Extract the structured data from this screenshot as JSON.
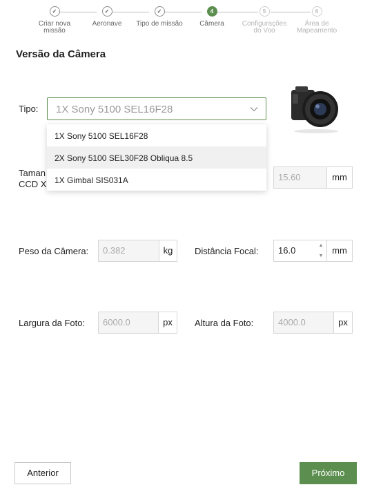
{
  "stepper": {
    "steps": [
      {
        "label1": "Criar nova",
        "label2": "missão",
        "state": "done",
        "num": ""
      },
      {
        "label1": "Aeronave",
        "label2": "",
        "state": "done",
        "num": ""
      },
      {
        "label1": "Tipo de missão",
        "label2": "",
        "state": "done",
        "num": ""
      },
      {
        "label1": "Câmera",
        "label2": "",
        "state": "active",
        "num": "4"
      },
      {
        "label1": "Configurações",
        "label2": "do Voo",
        "state": "todo",
        "num": "5"
      },
      {
        "label1": "Área de",
        "label2": "Mapeamento",
        "state": "todo",
        "num": "6"
      }
    ],
    "check_glyph": "✓"
  },
  "section_title": "Versão da Câmera",
  "tipo": {
    "label": "Tipo:",
    "selected": "1X Sony 5100 SEL16F28",
    "options": [
      "1X Sony 5100 SEL16F28",
      "2X Sony 5100 SEL30F28 Obliqua 8.5",
      "1X Gimbal SIS031A"
    ]
  },
  "sensor": {
    "label_line1": "Taman",
    "label_line2": "CCD X",
    "value": "15.60",
    "unit": "mm"
  },
  "peso": {
    "label": "Peso da Câmera:",
    "value": "0.382",
    "unit": "kg"
  },
  "distancia": {
    "label": "Distância Focal:",
    "value": "16.0",
    "unit": "mm",
    "up": "▲",
    "down": "▼"
  },
  "largura": {
    "label": "Largura da Foto:",
    "value": "6000.0",
    "unit": "px"
  },
  "altura": {
    "label": "Altura da Foto:",
    "value": "4000.0",
    "unit": "px"
  },
  "buttons": {
    "back": "Anterior",
    "next": "Próximo"
  },
  "colors": {
    "accent": "#5c8f4f",
    "border": "#d6d6d6",
    "disabled_bg": "#f5f5f5"
  },
  "icons": {
    "chevron": "chevron-down-icon",
    "camera": "camera-image"
  }
}
